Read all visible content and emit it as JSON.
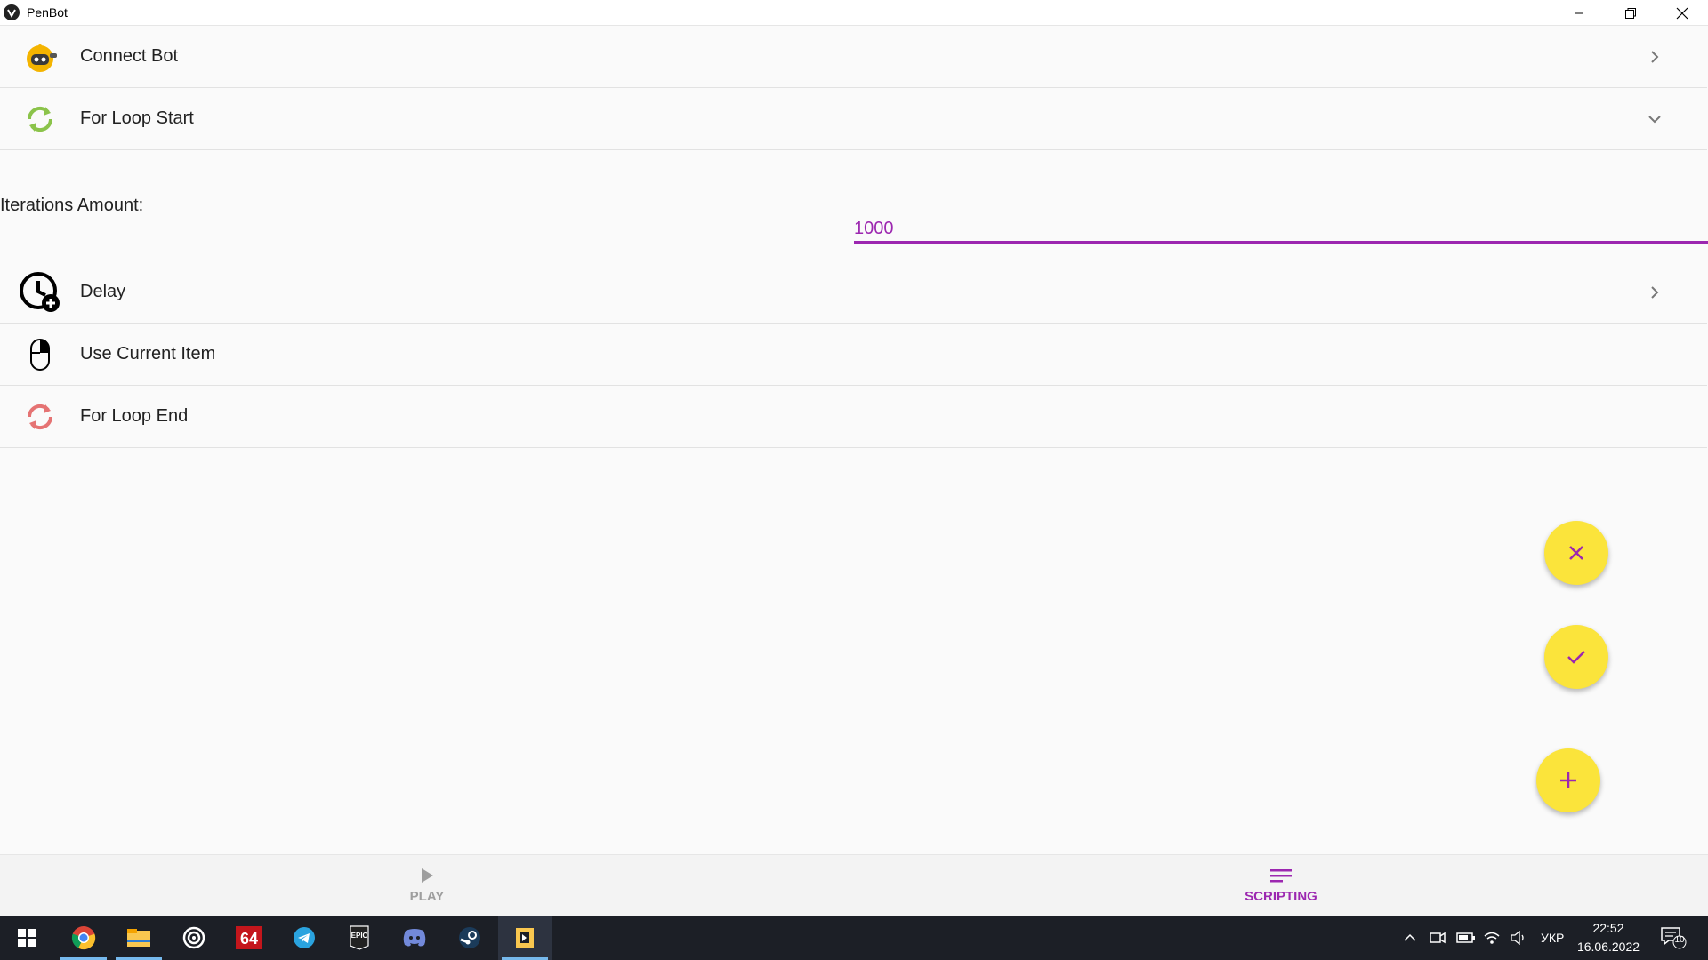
{
  "window": {
    "title": "PenBot"
  },
  "script_items": [
    {
      "label": "Connect Bot",
      "icon": "robot-icon",
      "chevron": "chevron-right-icon"
    },
    {
      "label": "For Loop Start",
      "icon": "loop-start-icon",
      "chevron": "chevron-down-icon"
    },
    {
      "label": "Delay",
      "icon": "clock-add-icon",
      "chevron": "chevron-right-icon"
    },
    {
      "label": "Use Current Item",
      "icon": "mouse-right-click-icon"
    },
    {
      "label": "For Loop End",
      "icon": "loop-end-icon"
    }
  ],
  "loop_settings": {
    "iterations_label": "Iterations Amount:",
    "iterations_value": "1000"
  },
  "fabs": [
    {
      "name": "cancel-button",
      "icon": "close-icon"
    },
    {
      "name": "confirm-button",
      "icon": "check-icon"
    },
    {
      "name": "add-button",
      "icon": "plus-icon"
    }
  ],
  "bottom_nav": {
    "play_label": "PLAY",
    "scripting_label": "SCRIPTING",
    "active": "scripting"
  },
  "taskbar": {
    "apps": [
      "windows-start-icon",
      "chrome-icon",
      "file-explorer-icon",
      "ubisoft-icon",
      "aida64-icon",
      "telegram-icon",
      "epic-games-icon",
      "discord-icon",
      "steam-icon",
      "penbot-icon"
    ],
    "language": "УКР",
    "time": "22:52",
    "date": "16.06.2022",
    "notifications": "10"
  },
  "colors": {
    "accent": "#9c27b0",
    "fab": "#fbe43b",
    "loop_start": "#8bc34a",
    "loop_end": "#e57373"
  }
}
